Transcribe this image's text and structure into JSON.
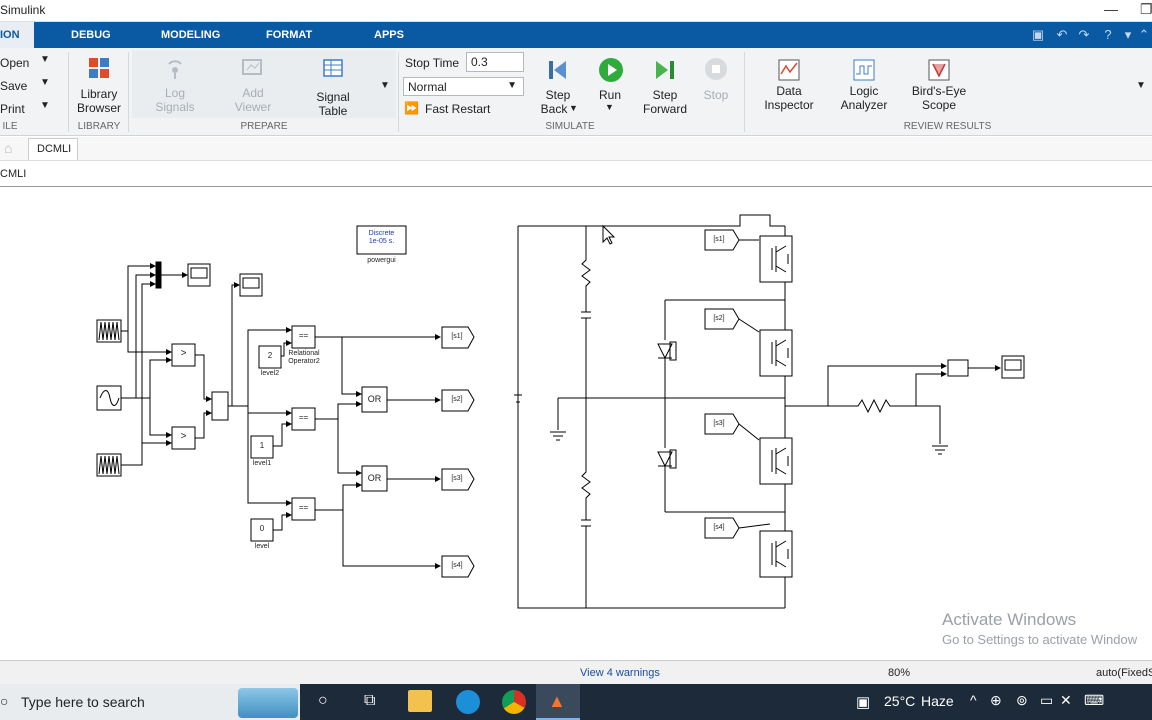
{
  "window": {
    "title": "Simulink"
  },
  "tabs": [
    "ION",
    "DEBUG",
    "MODELING",
    "FORMAT",
    "APPS"
  ],
  "file_menu": [
    {
      "label": "Open"
    },
    {
      "label": "Save"
    },
    {
      "label": "Print"
    }
  ],
  "file_group": "ILE",
  "library": {
    "label1": "Library",
    "label2": "Browser",
    "group": "LIBRARY"
  },
  "prepare": {
    "items": [
      {
        "l1": "Log",
        "l2": "Signals"
      },
      {
        "l1": "Add",
        "l2": "Viewer"
      },
      {
        "l1": "Signal",
        "l2": "Table"
      }
    ],
    "group": "PREPARE"
  },
  "simulate": {
    "stop_time_label": "Stop Time",
    "stop_time_value": "0.3",
    "mode_value": "Normal",
    "fast_restart": "Fast Restart",
    "step_back_l1": "Step",
    "step_back_l2": "Back",
    "run": "Run",
    "step_fwd_l1": "Step",
    "step_fwd_l2": "Forward",
    "stop": "Stop",
    "group": "SIMULATE"
  },
  "review": {
    "items": [
      {
        "l1": "Data",
        "l2": "Inspector"
      },
      {
        "l1": "Logic",
        "l2": "Analyzer"
      },
      {
        "l1": "Bird's-Eye",
        "l2": "Scope"
      }
    ],
    "group": "REVIEW RESULTS"
  },
  "model_tab": "DCMLI",
  "breadcrumb": "CMLI",
  "blocks": {
    "powergui_l1": "Discrete",
    "powergui_l2": "1e-05 s.",
    "powergui_name": "powergui",
    "const_level2": "2",
    "const_level2_name": "level2",
    "const_level1": "1",
    "const_level1_name": "level1",
    "const_level": "0",
    "const_level_name": "level",
    "relop_name_l1": "Relational",
    "relop_name_l2": "Operator2",
    "relop_sym": "==",
    "gt_sym": ">",
    "or_label": "OR",
    "goto_s1": "[s1]",
    "goto_s2": "[s2]",
    "goto_s3": "[s3]",
    "goto_s4": "[s4]"
  },
  "status": {
    "warnings": "View 4 warnings",
    "zoom": "80%",
    "solver": "auto(FixedS"
  },
  "watermark": {
    "line1": "Activate Windows",
    "line2": "Go to Settings to activate Window"
  },
  "taskbar": {
    "search_placeholder": "Type here to search",
    "weather_temp": "25°C",
    "weather_desc": "Haze"
  }
}
